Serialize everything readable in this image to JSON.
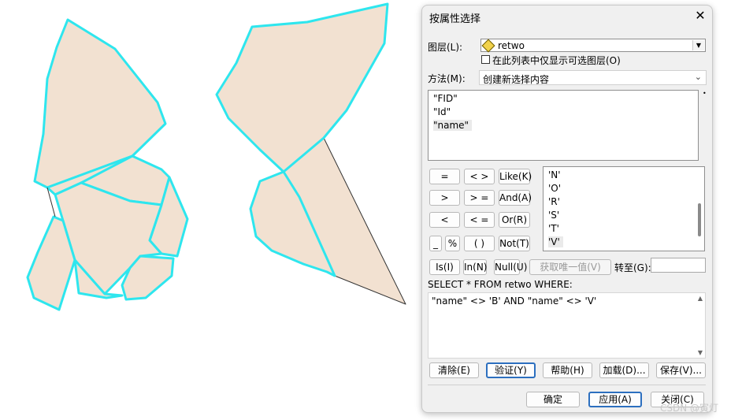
{
  "dialog": {
    "title": "按属性选择",
    "layer_label": "图层(L):",
    "layer_value": "retwo",
    "checkbox_label": "在此列表中仅显示可选图层(O)",
    "method_label": "方法(M):",
    "method_value": "创建新选择内容",
    "fields": [
      "\"FID\"",
      "\"Id\"",
      "\"name\""
    ],
    "operators": {
      "eq": "=",
      "ne": "< >",
      "like": "Like(K)",
      "gt": ">",
      "ge": "> =",
      "and": "And(A)",
      "lt": "<",
      "le": "< =",
      "or": "Or(R)",
      "underscore": "_",
      "percent": "%",
      "parens": "( )",
      "not": "Not(T)",
      "is": "Is(I)",
      "in": "In(N)",
      "null": "Null(U)"
    },
    "values": [
      "'N'",
      "'O'",
      "'R'",
      "'S'",
      "'T'",
      "'V'"
    ],
    "get_unique_label": "获取唯一值(V)",
    "goto_label": "转至(G):",
    "sql_prefix": "SELECT * FROM retwo WHERE:",
    "expression": "\"name\" <> 'B' AND \"name\" <> 'V'",
    "buttons": {
      "clear": "清除(E)",
      "verify": "验证(Y)",
      "help": "帮助(H)",
      "load": "加载(D)...",
      "save": "保存(V)..."
    },
    "footer": {
      "ok": "确定",
      "apply": "应用(A)",
      "close": "关闭(C)"
    }
  },
  "watermark": "CSDN @寅灯",
  "colors": {
    "polygon_fill": "#f2e1d1",
    "outline_cyan": "#2ee6ee",
    "outline_black": "#333333"
  }
}
